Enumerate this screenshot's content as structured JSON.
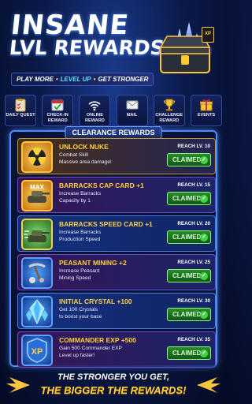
{
  "hero": {
    "title_line1": "INSANE",
    "title_line2": "LVL REWARDS!",
    "tagline": {
      "part1": "PLAY MORE",
      "part2": "LEVEL UP",
      "part3": "GET STRONGER"
    },
    "chest_badge": "XP"
  },
  "nav": [
    {
      "label": "DAILY QUEST",
      "icon": "clipboard-icon"
    },
    {
      "label": "CHECK-IN REWARD",
      "icon": "calendar-check-icon"
    },
    {
      "label": "ONLINE REWARD",
      "icon": "wifi-icon"
    },
    {
      "label": "MAIL",
      "icon": "mail-icon"
    },
    {
      "label": "CHALLENGE REWARD",
      "icon": "trophy-icon"
    },
    {
      "label": "EVENTS",
      "icon": "gift-icon"
    }
  ],
  "panel": {
    "title": "CLEARANCE REWARDS",
    "claimed_label": "CLAIMED",
    "rewards": [
      {
        "title": "UNLOCK NUKE",
        "desc1": "Combat Skill",
        "desc2": "Massive area damage!",
        "req": "REACH LV. 10",
        "icon": "nuke-icon"
      },
      {
        "title": "BARRACKS CAP CARD +1",
        "desc1": "Increase Barracks",
        "desc2": "Capacity by 1",
        "req": "REACH LV. 15",
        "icon": "tank-max-icon"
      },
      {
        "title": "BARRACKS SPEED CARD +1",
        "desc1": "Increase Barracks",
        "desc2": "Production Speed",
        "req": "REACH LV. 20",
        "icon": "tank-speed-icon"
      },
      {
        "title": "PEASANT MINING +2",
        "desc1": "Increase Peasant",
        "desc2": "Mining Speed",
        "req": "REACH LV. 25",
        "icon": "mining-icon"
      },
      {
        "title": "INITIAL CRYSTAL +100",
        "desc1": "Get 100 Crystals",
        "desc2": "to boost your base",
        "req": "REACH LV. 30",
        "icon": "crystal-icon"
      },
      {
        "title": "COMMANDER EXP +500",
        "desc1": "Gain 500 Commander EXP",
        "desc2": "Level up faster!",
        "req": "REACH LV. 35",
        "icon": "xp-icon"
      }
    ]
  },
  "footer": {
    "line1": "THE STRONGER YOU GET,",
    "line2": "THE BIGGER THE REWARDS!"
  }
}
